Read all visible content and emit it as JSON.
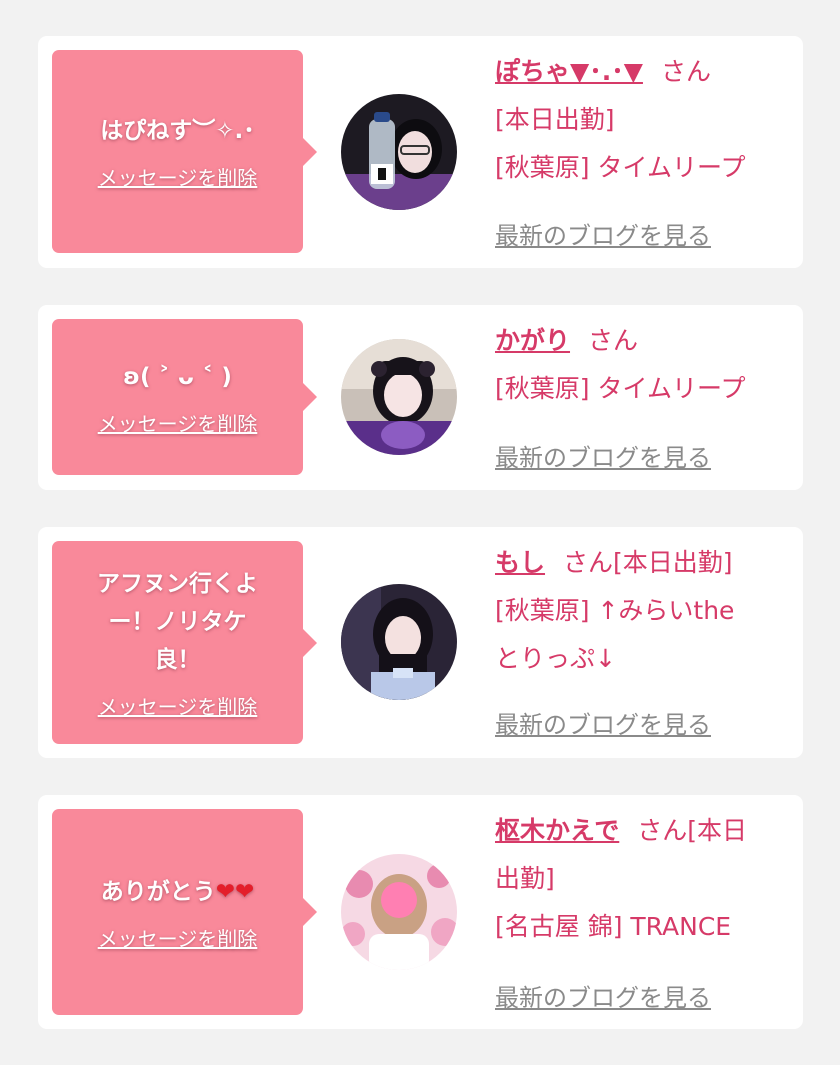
{
  "cards": [
    {
      "message": "はぴねす︶✧.･",
      "delete_label": "メッセージを削除",
      "name": "ぽちゃ▼･.･▼",
      "san": "さん",
      "lines": [
        "[本日出勤]",
        "[秋葉原] タイムリープ"
      ],
      "blog_label": "最新のブログを見る"
    },
    {
      "message": "ʚ( ˃ ᴗ ˂ )",
      "delete_label": "メッセージを削除",
      "name": "かがり",
      "san": "さん",
      "lines": [
        "[秋葉原] タイムリープ"
      ],
      "blog_label": "最新のブログを見る"
    },
    {
      "message": "アフヌン行くよー！ノリタケ良！",
      "delete_label": "メッセージを削除",
      "name": "もし",
      "san": "さん[本日出勤]",
      "lines": [
        "[秋葉原] ↑みらいthe",
        "とりっぷ↓"
      ],
      "blog_label": "最新のブログを見る"
    },
    {
      "message": "ありがとう",
      "message_hearts": "❤❤",
      "delete_label": "メッセージを削除",
      "name": "枢木かえで",
      "san": "さん[本日",
      "lines": [
        "出勤]",
        "[名古屋 錦] TRANCE"
      ],
      "blog_label": "最新のブログを見る"
    }
  ],
  "colors": {
    "background": "#f2f2f2",
    "bubble": "#f9899a",
    "accent": "#d63a68",
    "link_gray": "#8a8a8a"
  },
  "icons": [
    "avatar-photo"
  ]
}
